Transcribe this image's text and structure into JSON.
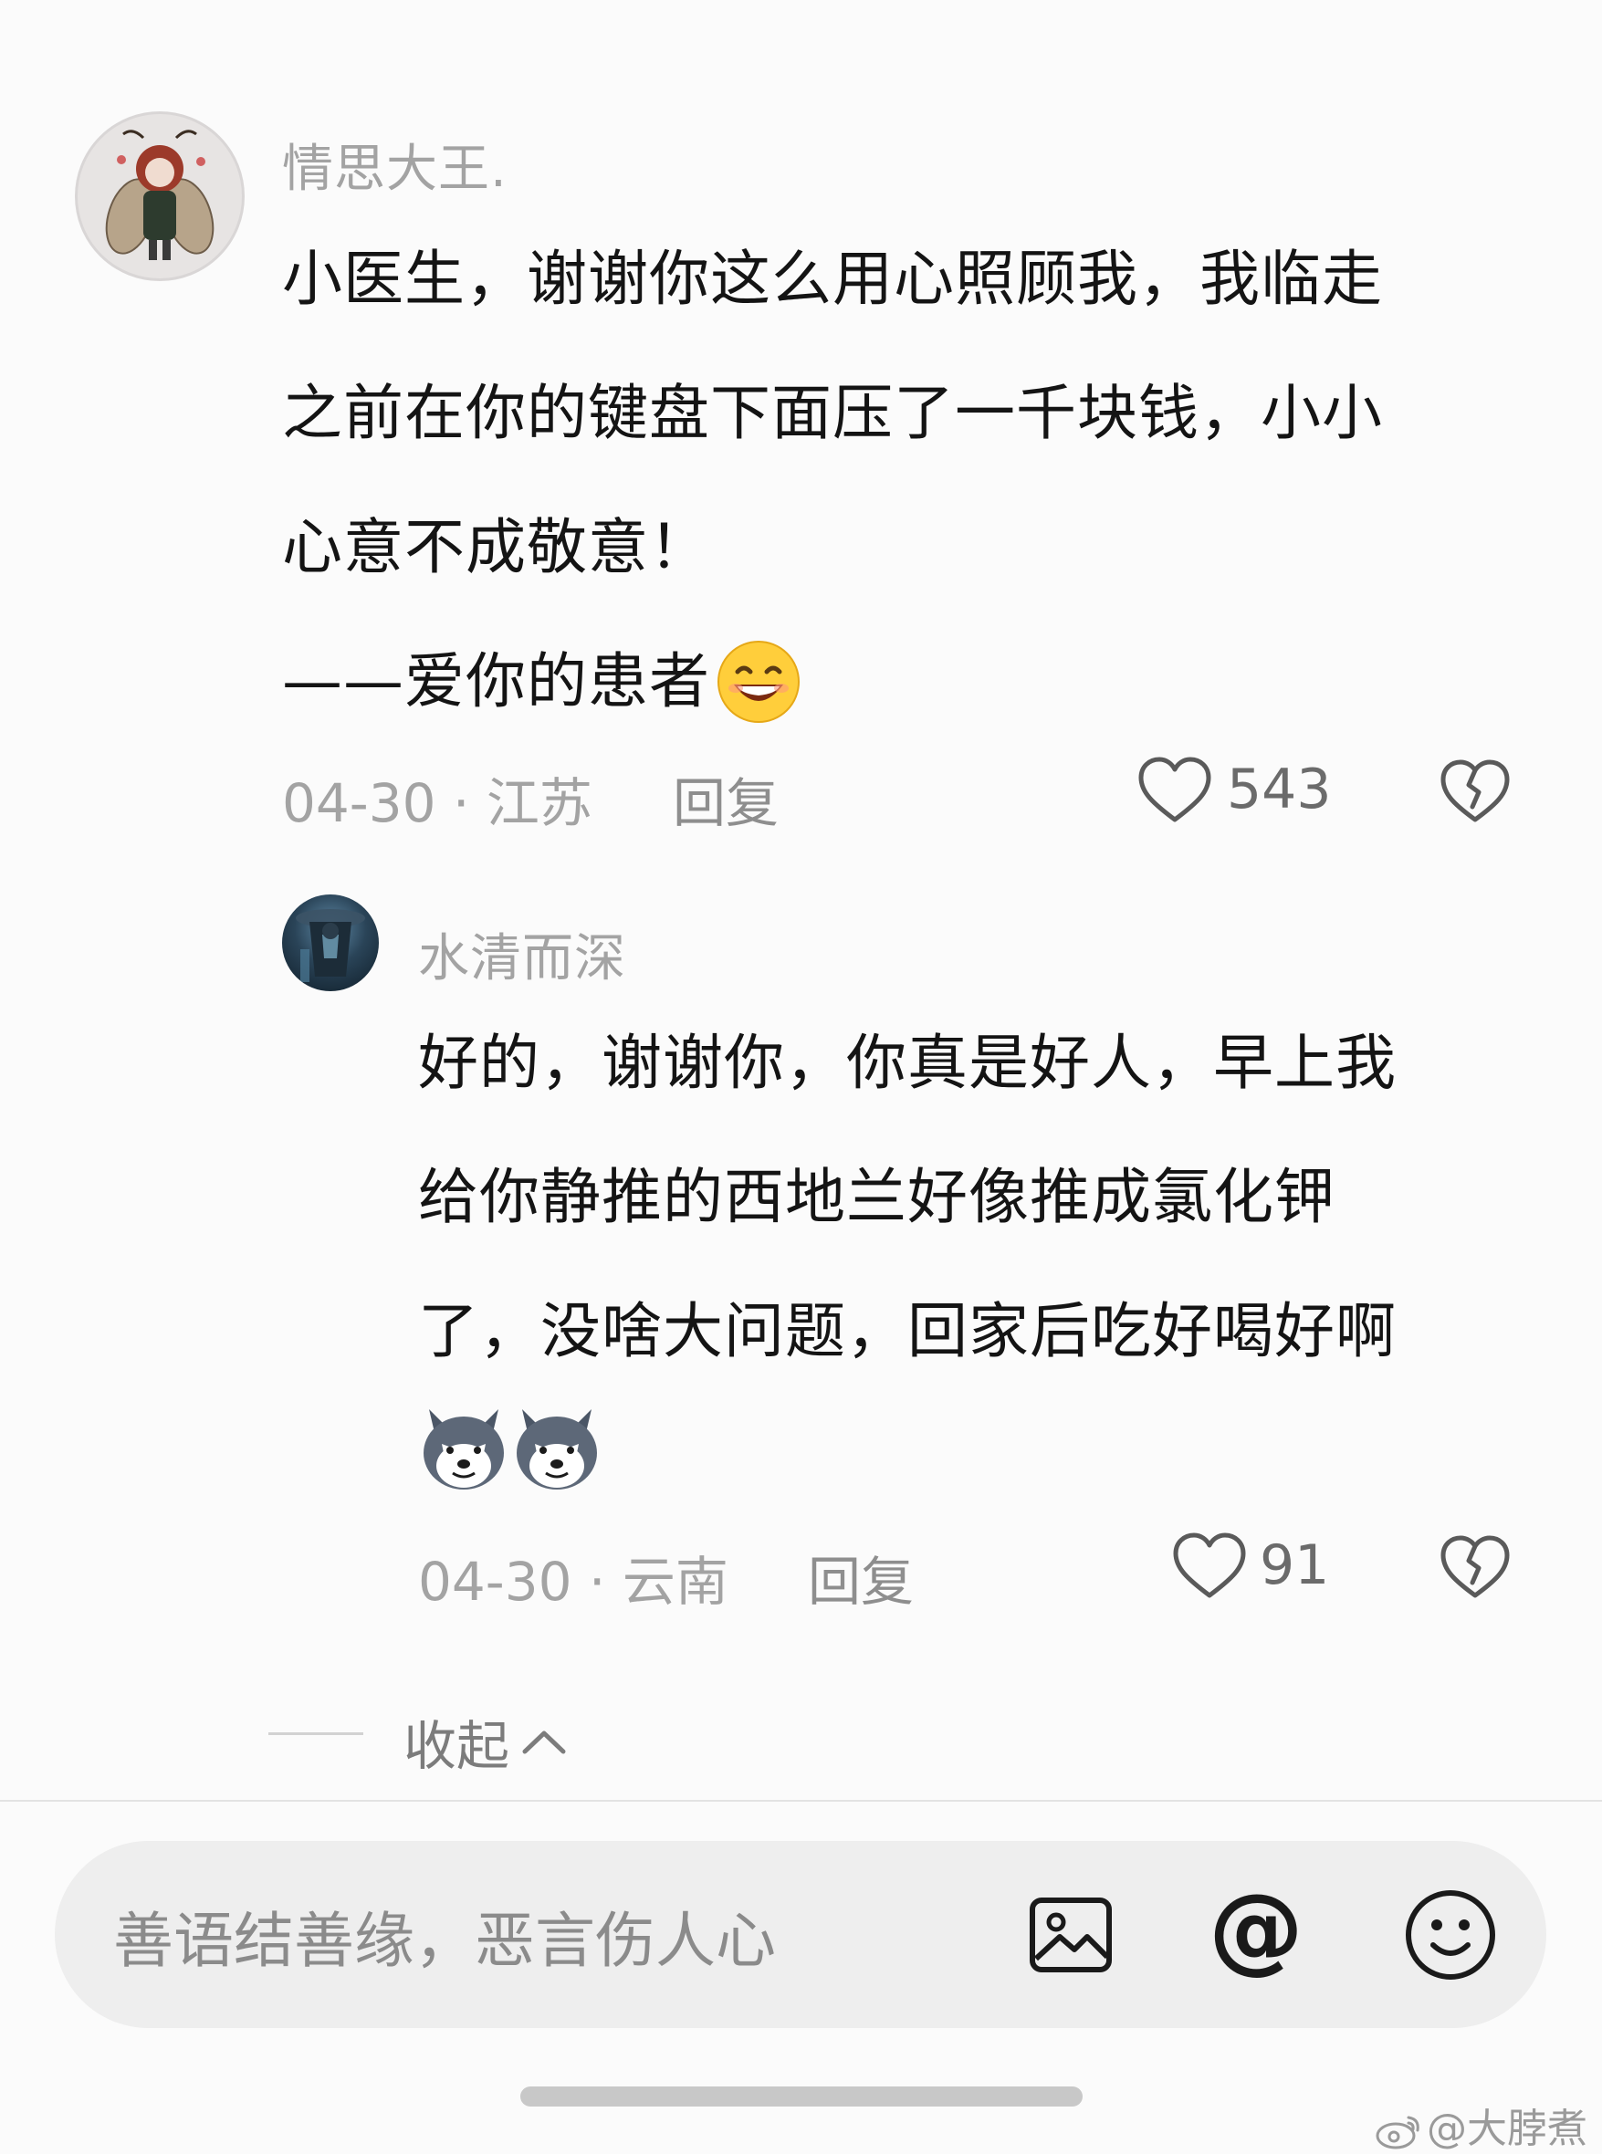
{
  "comment": {
    "username": "情思大王.",
    "lines": [
      "小医生，谢谢你这么用心照顾我，我临走",
      "之前在你的键盘下面压了一千块钱，小小",
      "心意不成敬意！",
      "——爱你的患者"
    ],
    "date_location": "04-30 · 江苏",
    "reply_label": "回复",
    "like_count": "543"
  },
  "reply": {
    "username": "水清而深",
    "lines": [
      "好的，谢谢你，你真是好人，早上我",
      "给你静推的西地兰好像推成氯化钾",
      "了，没啥大问题，回家后吃好喝好啊"
    ],
    "date_location": "04-30 · 云南",
    "reply_label": "回复",
    "like_count": "91"
  },
  "collapse_label": "收起",
  "input": {
    "placeholder": "善语结善缘，恶言伤人心"
  },
  "watermark": "@大脖煮"
}
